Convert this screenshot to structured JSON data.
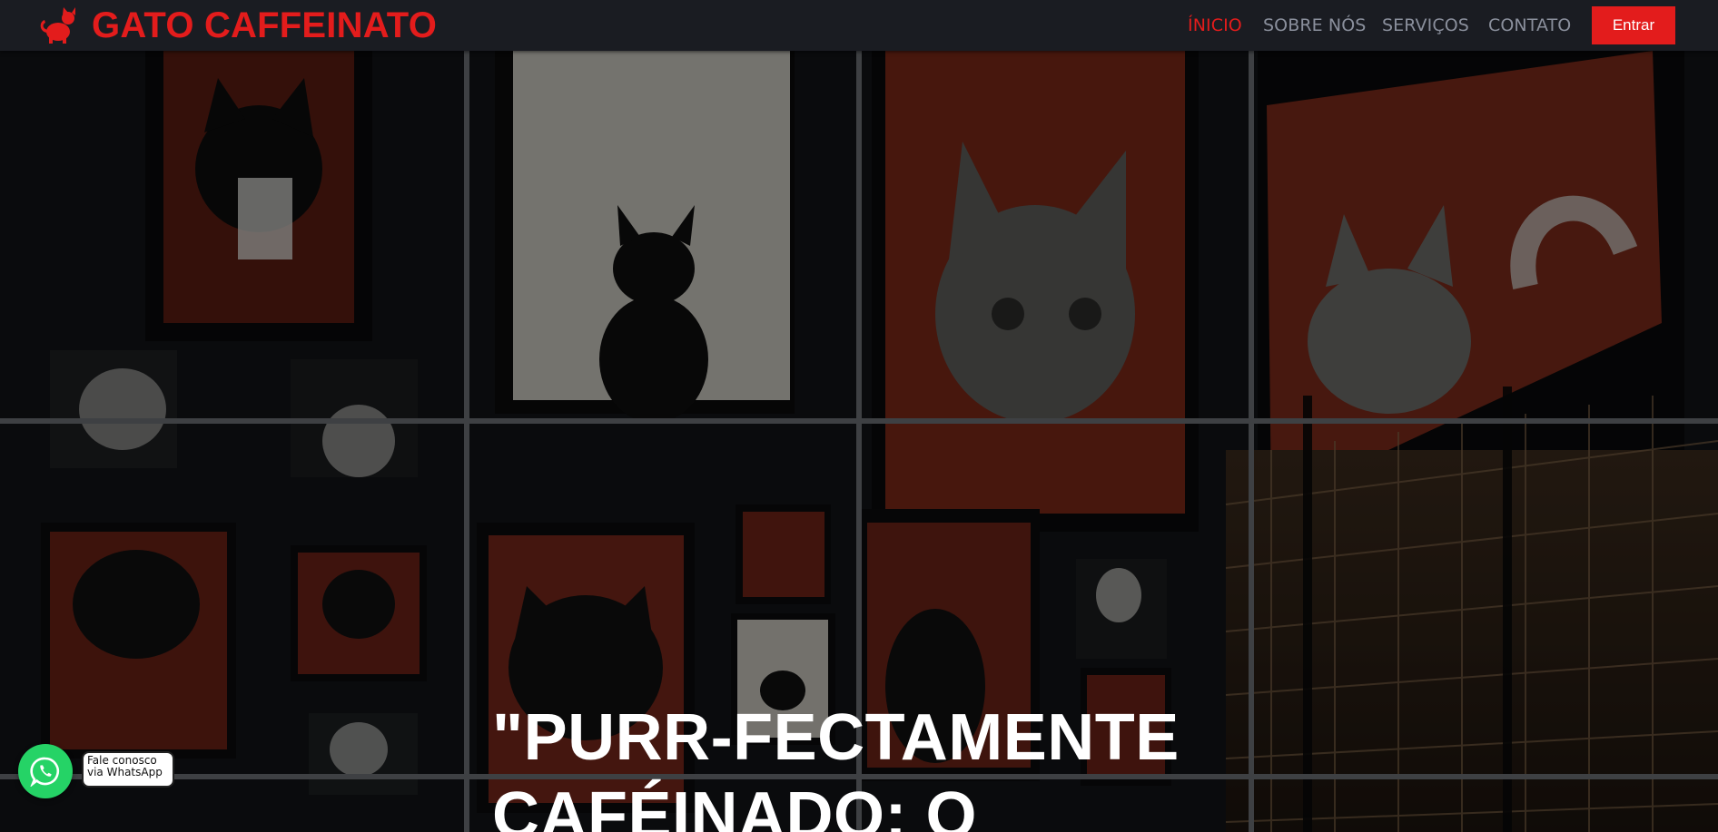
{
  "brand": {
    "name": "GATO CAFFEINATO",
    "icon": "cat-icon",
    "color": "#e31c1c"
  },
  "nav": {
    "items": [
      {
        "label": "ÍNICIO",
        "active": true
      },
      {
        "label": "SOBRE NÓS",
        "active": false
      },
      {
        "label": "SERVIÇOS",
        "active": false
      },
      {
        "label": "CONTATO",
        "active": false
      }
    ],
    "login_label": "Entrar"
  },
  "hero": {
    "title": "\"PURR-FECTAMENTE CAFÉINADO: O"
  },
  "whatsapp": {
    "tooltip": "Fale conosco via WhatsApp",
    "icon": "whatsapp-icon",
    "color": "#25d366"
  },
  "colors": {
    "accent": "#e31c1c",
    "navbar_bg": "#1a1c22",
    "nav_text": "#8a8f9c"
  }
}
